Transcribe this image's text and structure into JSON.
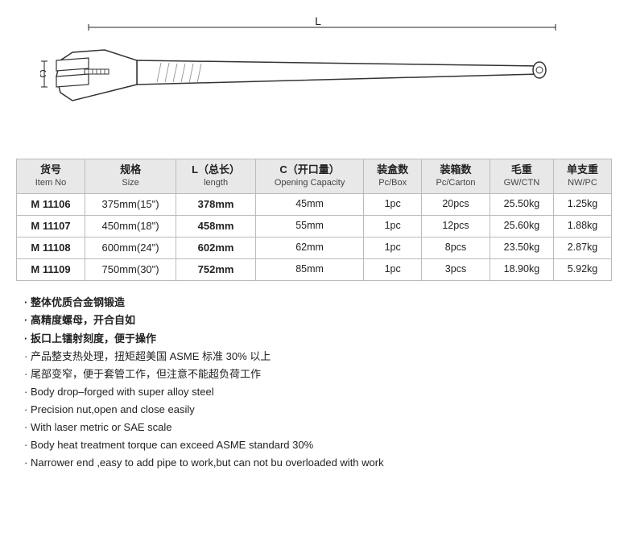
{
  "diagram": {
    "label_L": "L",
    "label_C": "C"
  },
  "table": {
    "headers": [
      {
        "main": "货号",
        "sub": "Item No"
      },
      {
        "main": "规格",
        "sub": "Size"
      },
      {
        "main": "L（总长）",
        "sub": "length"
      },
      {
        "main": "C（开口量）",
        "sub": "Opening Capacity"
      },
      {
        "main": "装盒数",
        "sub": "Pc/Box"
      },
      {
        "main": "装箱数",
        "sub": "Pc/Carton"
      },
      {
        "main": "毛重",
        "sub": "GW/CTN"
      },
      {
        "main": "单支重",
        "sub": "NW/PC"
      }
    ],
    "rows": [
      {
        "item": "M 11106",
        "size": "375mm(15\")",
        "length": "378mm",
        "opening": "45mm",
        "pc_box": "1pc",
        "pc_carton": "20pcs",
        "gw": "25.50kg",
        "nw": "1.25kg"
      },
      {
        "item": "M 11107",
        "size": "450mm(18\")",
        "length": "458mm",
        "opening": "55mm",
        "pc_box": "1pc",
        "pc_carton": "12pcs",
        "gw": "25.60kg",
        "nw": "1.88kg"
      },
      {
        "item": "M 11108",
        "size": "600mm(24\")",
        "length": "602mm",
        "opening": "62mm",
        "pc_box": "1pc",
        "pc_carton": "8pcs",
        "gw": "23.50kg",
        "nw": "2.87kg"
      },
      {
        "item": "M 11109",
        "size": "750mm(30\")",
        "length": "752mm",
        "opening": "85mm",
        "pc_box": "1pc",
        "pc_carton": "3pcs",
        "gw": "18.90kg",
        "nw": "5.92kg"
      }
    ]
  },
  "features": [
    {
      "text": "整体优质合金钢锻造",
      "bold": true
    },
    {
      "text": "高精度螺母，开合自如",
      "bold": true
    },
    {
      "text": "扳口上镭射刻度，便于操作",
      "bold": true
    },
    {
      "text": "产品整支热处理，扭矩超美国 ASME 标准 30% 以上",
      "bold": false
    },
    {
      "text": "尾部变窄，便于套管工作，但注意不能超负荷工作",
      "bold": false
    },
    {
      "text": "Body drop–forged with super alloy steel",
      "bold": false
    },
    {
      "text": "Precision nut,open and close easily",
      "bold": false
    },
    {
      "text": "With laser metric or SAE scale",
      "bold": false
    },
    {
      "text": "Body heat treatment torque can exceed ASME standard 30%",
      "bold": false
    },
    {
      "text": "Narrower end ,easy to add pipe to work,but can not bu overloaded with work",
      "bold": false
    }
  ]
}
